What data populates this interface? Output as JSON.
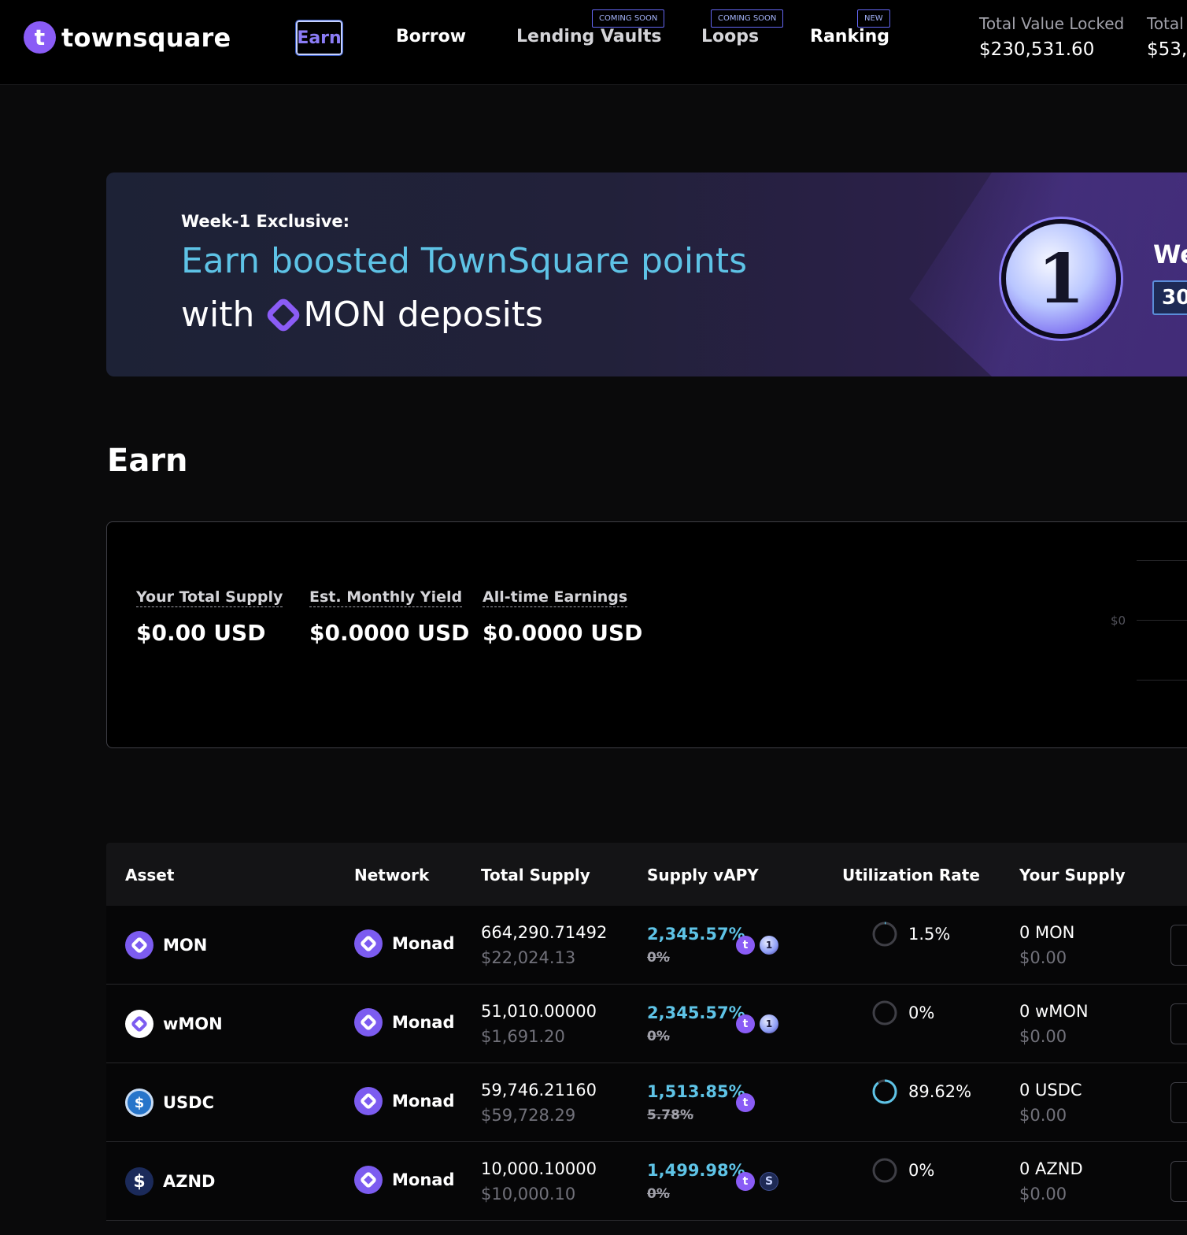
{
  "brand": {
    "logo_letter": "t",
    "name": "townsquare"
  },
  "nav": {
    "items": [
      {
        "label": "Earn",
        "active": true
      },
      {
        "label": "Borrow"
      },
      {
        "label": "Lending Vaults",
        "badge": "COMING SOON"
      },
      {
        "label": "Loops",
        "badge": "COMING SOON"
      },
      {
        "label": "Ranking",
        "badge": "NEW"
      }
    ]
  },
  "stats": [
    {
      "label": "Total Value Locked",
      "value": "$230,531.60"
    },
    {
      "label": "Total",
      "value": "$53,"
    }
  ],
  "banner": {
    "kicker": "Week-1 Exclusive:",
    "title": "Earn boosted TownSquare points",
    "sub_prefix": "with",
    "sub_suffix": "MON deposits",
    "coin_glyph": "1",
    "right_title": "We",
    "right_chip": "30"
  },
  "earn": {
    "title": "Earn",
    "summary": [
      {
        "label": "Your Total Supply",
        "value": "$0.00 USD"
      },
      {
        "label": "Est. Monthly Yield",
        "value": "$0.0000 USD"
      },
      {
        "label": "All-time Earnings",
        "value": "$0.0000 USD"
      }
    ],
    "chart_tick": "$0"
  },
  "table": {
    "headers": [
      "Asset",
      "Network",
      "Total Supply",
      "Supply vAPY",
      "Utilization Rate",
      "Your Supply"
    ],
    "rows": [
      {
        "asset": "MON",
        "network": "Monad",
        "total_supply": "664,290.71492",
        "total_supply_usd": "$22,024.13",
        "apy": "2,345.57%",
        "apy_old": "0%",
        "points": [
          "t",
          "1"
        ],
        "utilization": "1.5%",
        "utilization_frac": 0.015,
        "your_supply": "0 MON",
        "your_supply_usd": "$0.00"
      },
      {
        "asset": "wMON",
        "network": "Monad",
        "total_supply": "51,010.00000",
        "total_supply_usd": "$1,691.20",
        "apy": "2,345.57%",
        "apy_old": "0%",
        "points": [
          "t",
          "1"
        ],
        "utilization": "0%",
        "utilization_frac": 0,
        "your_supply": "0 wMON",
        "your_supply_usd": "$0.00"
      },
      {
        "asset": "USDC",
        "network": "Monad",
        "total_supply": "59,746.21160",
        "total_supply_usd": "$59,728.29",
        "apy": "1,513.85%",
        "apy_old": "5.78%",
        "points": [
          "t"
        ],
        "utilization": "89.62%",
        "utilization_frac": 0.8962,
        "your_supply": "0 USDC",
        "your_supply_usd": "$0.00"
      },
      {
        "asset": "AZND",
        "network": "Monad",
        "total_supply": "10,000.10000",
        "total_supply_usd": "$10,000.10",
        "apy": "1,499.98%",
        "apy_old": "0%",
        "points": [
          "t",
          "S"
        ],
        "utilization": "0%",
        "utilization_frac": 0,
        "your_supply": "0 AZND",
        "your_supply_usd": "$0.00"
      }
    ]
  },
  "colors": {
    "accent": "#8a5cf6",
    "apy": "#5ec3e6",
    "ring": "#5ec3e6"
  }
}
